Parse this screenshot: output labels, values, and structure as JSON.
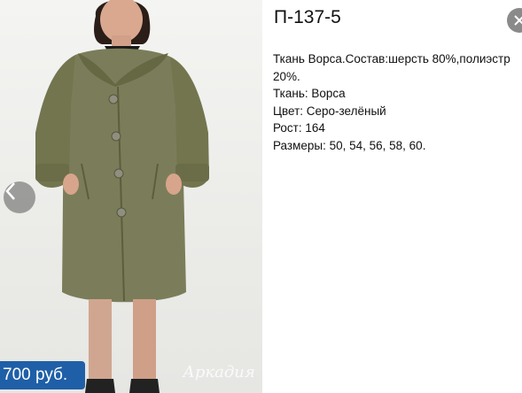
{
  "product": {
    "title": "П-137-5",
    "description_lines": [
      "Ткань Ворса.Состав:шерсть 80%,полиэстр",
      "20%.",
      "Ткань: Ворса",
      "Цвет: Серо-зелёный",
      "Рост: 164",
      "Размеры: 50, 54, 56, 58, 60."
    ]
  },
  "gallery": {
    "price": "700 руб.",
    "watermark": "Аркадия",
    "prev_icon": "chevron-left-icon",
    "close_icon": "close-icon"
  },
  "colors": {
    "price_badge": "#1f5fa8",
    "coat": "#7b7d5a"
  }
}
